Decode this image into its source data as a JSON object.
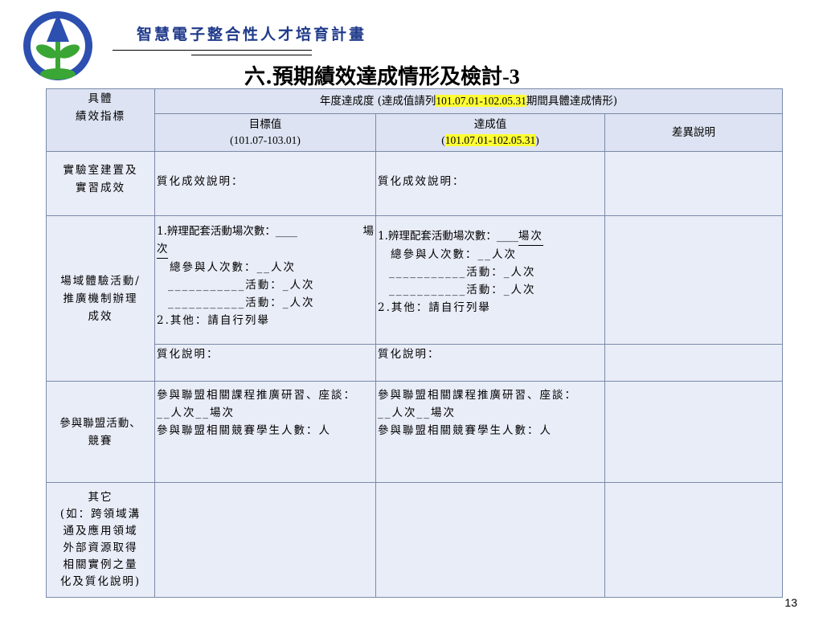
{
  "header": {
    "program_title": "智慧電子整合性人才培育計畫",
    "slide_title": "六.預期績效達成情形及檢討",
    "slide_title_suffix": "-3"
  },
  "table": {
    "col_indicator": [
      "具體",
      "績效指標"
    ],
    "col_annual_prefix": "年度達成度 (達成值請列",
    "col_annual_highlight": "101.07.01-102.05.31",
    "col_annual_suffix": "期間具體達成情形)",
    "col_target": [
      "目標值",
      "(101.07-103.01)"
    ],
    "col_achieved_label": "達成值",
    "col_achieved_open": "(",
    "col_achieved_highlight": "101.07.01-102.05.31",
    "col_achieved_close": ")",
    "col_diff": "差異說明",
    "rows": {
      "lab": {
        "label": [
          "實驗室建置及",
          "實習成效"
        ],
        "target": "質化成效說明：",
        "achieved": "質化成效說明："
      },
      "field": {
        "label": [
          "場域體驗活動/",
          "推廣機制辦理",
          "成效"
        ],
        "target_line1_prefix": "1.辨理配套活動場次數：",
        "target_line1_blank": "____",
        "target_line1_unit": "場",
        "target_line1_wrap": "次",
        "target_participants": "總參與人次數：__人次",
        "target_activity1_blank": "___________",
        "target_activity1": "活動：_人次",
        "target_activity2_blank": "___________",
        "target_activity2": "活動：_人次",
        "target_other": "2.其他：請自行列舉",
        "achieved_line1_prefix": "1.辨理配套活動場次數：",
        "achieved_line1_blank": "____",
        "achieved_line1_unit": "場次",
        "achieved_participants": "總參與人次數：__人次",
        "achieved_activity1_blank": "___________",
        "achieved_activity1": "活動：_人次",
        "achieved_activity2_blank": "___________",
        "achieved_activity2": "活動：_人次",
        "achieved_other": "2.其他：請自行列舉",
        "qual_target": "質化說明：",
        "qual_achieved": "質化說明："
      },
      "alliance": {
        "label": [
          "參與聯盟活動、",
          "競賽"
        ],
        "target_line1": "參與聯盟相關課程推廣研習、座談：",
        "target_line2": "__人次__場次",
        "target_line3": "參與聯盟相關競賽學生人數：人",
        "achieved_line1": "參與聯盟相關課程推廣研習、座談：",
        "achieved_line2": "__人次__場次",
        "achieved_line3": "參與聯盟相關競賽學生人數：人"
      },
      "other": {
        "label": [
          "其它",
          "(如：跨領域溝",
          "通及應用領域",
          "外部資源取得",
          "相關實例之量",
          "化及質化說明)"
        ]
      }
    }
  },
  "footer": {
    "page_number": "13"
  },
  "colors": {
    "header_fill": "#dde3f2",
    "body_fill": "#e9edf8",
    "highlight": "#ffff33",
    "title_blue": "#1f3a8a",
    "logo_blue": "#2c4fb0",
    "logo_green": "#3aa635"
  },
  "icons": {
    "logo": "plant-sprout-logo"
  }
}
